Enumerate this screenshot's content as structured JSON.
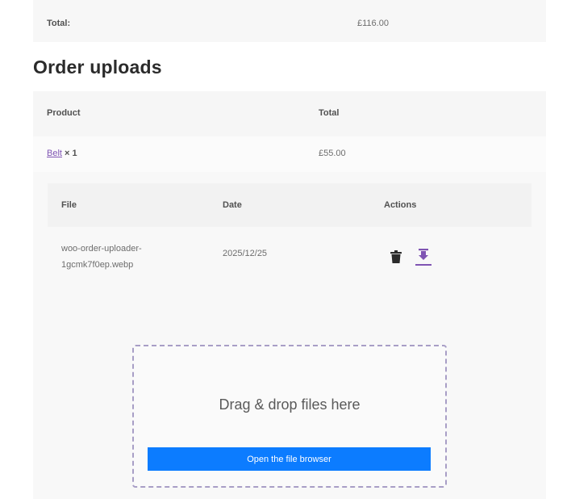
{
  "order_total": {
    "label": "Total:",
    "value": "£116.00"
  },
  "uploads": {
    "title": "Order uploads",
    "columns": {
      "product": "Product",
      "total": "Total"
    },
    "product_row": {
      "name": "Belt",
      "quantity": "× 1",
      "total": "£55.00"
    },
    "files_table": {
      "columns": {
        "file": "File",
        "date": "Date",
        "actions": "Actions"
      },
      "rows": [
        {
          "file_line1": "woo-order-uploader-",
          "file_line2": "1gcmk7f0ep.webp",
          "date": "2025/12/25",
          "actions": [
            "trash-icon",
            "download-icon"
          ]
        }
      ]
    },
    "dropzone": {
      "text": "Drag & drop files here",
      "button_label": "Open the file browser"
    }
  },
  "colors": {
    "accent_link": "#7f54b3",
    "button_bg": "#0c7cff",
    "dropzone_border": "#a89ec6"
  }
}
